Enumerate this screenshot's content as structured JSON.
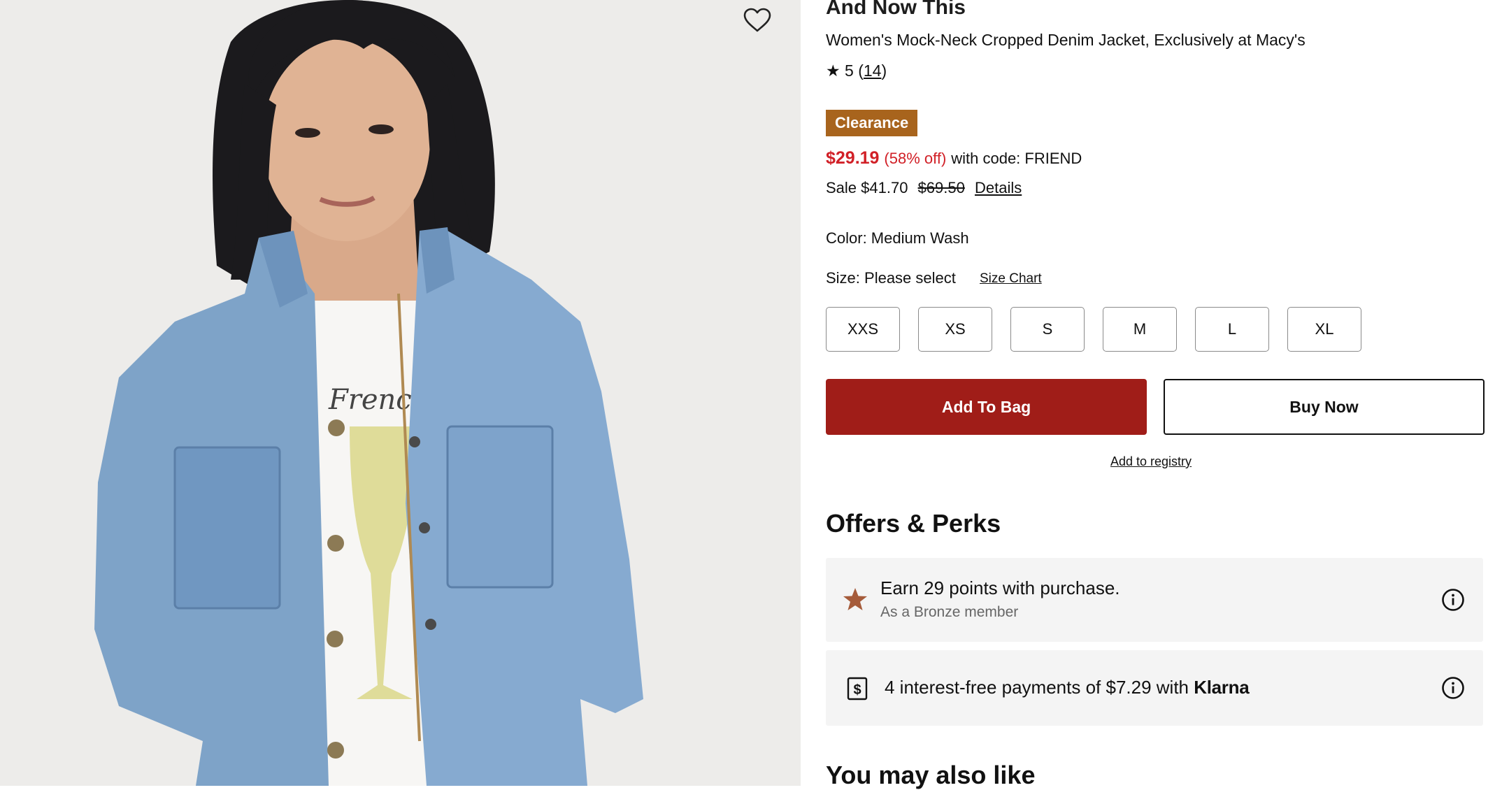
{
  "product": {
    "brand": "And Now This",
    "title": "Women's Mock-Neck Cropped Denim Jacket, Exclusively at Macy's",
    "rating_star": "★",
    "rating": "5",
    "review_count": "14",
    "badge": "Clearance",
    "price": "$29.19",
    "discount": "(58% off)",
    "code_text": "with code: FRIEND",
    "sale_label": "Sale $41.70",
    "original_price": "$69.50",
    "details_link": "Details",
    "color_label": "Color: Medium Wash",
    "size_label": "Size: Please select",
    "size_chart": "Size Chart",
    "sizes": [
      "XXS",
      "XS",
      "S",
      "M",
      "L",
      "XL"
    ],
    "print_text": "French"
  },
  "actions": {
    "add_to_bag": "Add To Bag",
    "buy_now": "Buy Now",
    "registry": "Add to registry"
  },
  "offers": {
    "title": "Offers & Perks",
    "perks": [
      {
        "main": "Earn 29 points with purchase.",
        "sub": "As a Bronze member",
        "icon": "star-icon"
      },
      {
        "main": "4 interest-free payments of $7.29 with",
        "brand": "Klarna",
        "icon": "dollar-card-icon"
      }
    ]
  },
  "related": {
    "title": "You may also like"
  },
  "colors": {
    "accent_red": "#d12027",
    "bag_button": "#a01d18",
    "clearance_badge": "#a8641d",
    "perk_bg": "#f4f4f4",
    "bronze_star": "#a55b3a"
  }
}
